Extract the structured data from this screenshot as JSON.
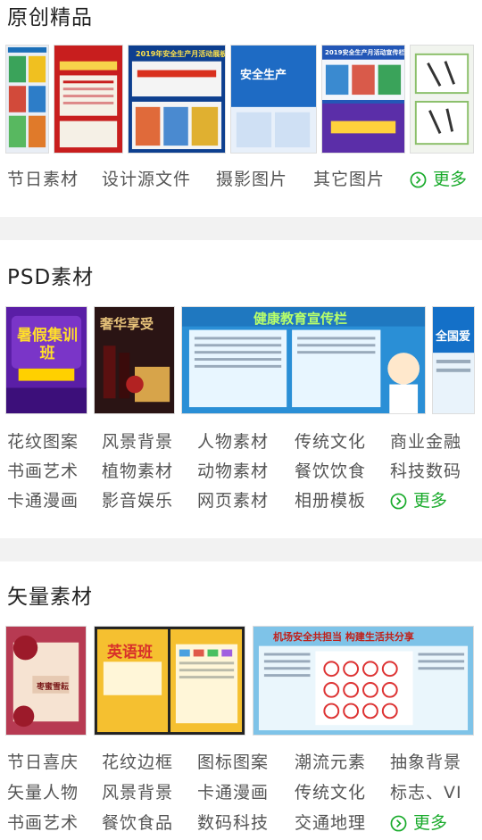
{
  "sections": [
    {
      "title": "原创精品",
      "categories": [
        "节日素材",
        "设计源文件",
        "摄影图片",
        "其它图片"
      ],
      "more_label": "更多",
      "thumb_texts": [
        "",
        "",
        "2019年安全生产月活动展板",
        "安全生产",
        "2019安全生产月活动宣传栏",
        ""
      ]
    },
    {
      "title": "PSD素材",
      "categories": [
        "花纹图案",
        "风景背景",
        "人物素材",
        "传统文化",
        "商业金融",
        "书画艺术",
        "植物素材",
        "动物素材",
        "餐饮饮食",
        "科技数码",
        "卡通漫画",
        "影音娱乐",
        "网页素材",
        "相册模板"
      ],
      "more_label": "更多",
      "thumb_texts": [
        "暑假集训班",
        "奢华享受",
        "健康教育宣传栏",
        "全国爱"
      ]
    },
    {
      "title": "矢量素材",
      "categories": [
        "节日喜庆",
        "花纹边框",
        "图标图案",
        "潮流元素",
        "抽象背景",
        "矢量人物",
        "风景背景",
        "卡通漫画",
        "传统文化",
        "标志、VI",
        "书画艺术",
        "餐饮食品",
        "数码科技",
        "交通地理"
      ],
      "more_label": "更多",
      "thumb_texts": [
        "枣蜜雪耘",
        "英语班",
        "",
        "机场安全共担当 构建生活共分享"
      ]
    }
  ],
  "colors": {
    "accent": "#1aab2c",
    "separator": "#f2f2f2"
  },
  "icons": {
    "more": "circle-chevron-right-icon"
  }
}
